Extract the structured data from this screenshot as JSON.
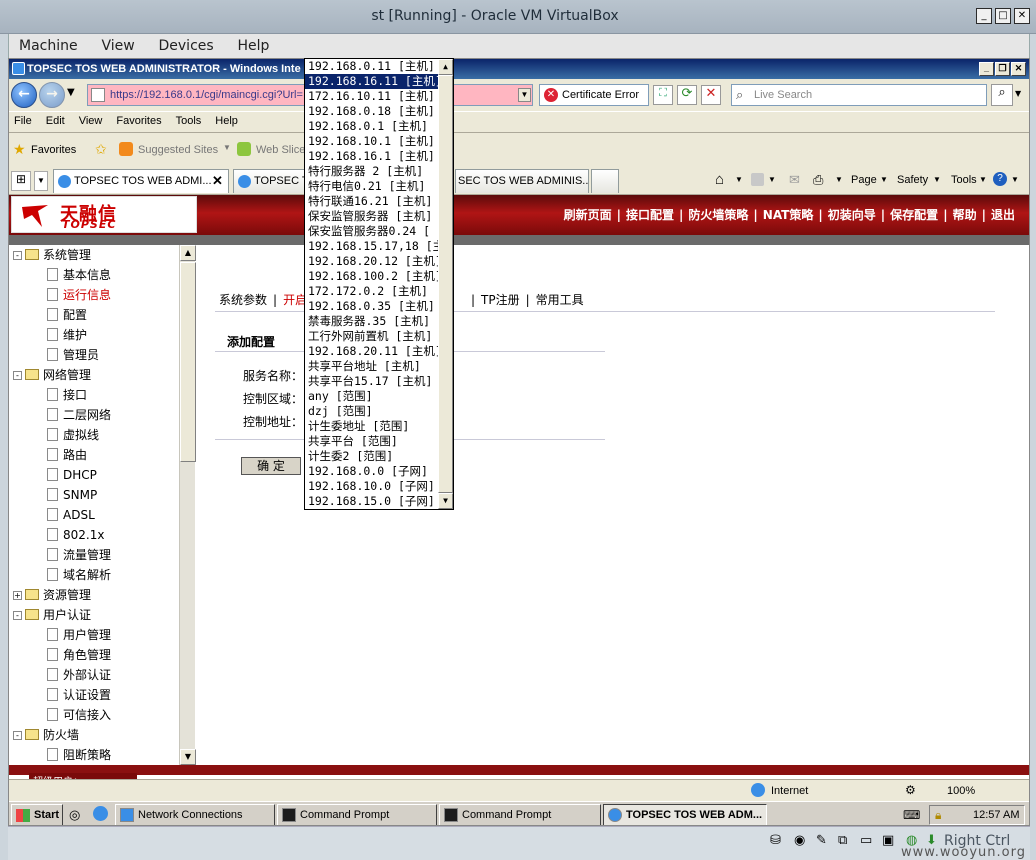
{
  "vbox": {
    "title": "st [Running] - Oracle VM VirtualBox",
    "menu": [
      "Machine",
      "View",
      "Devices",
      "Help"
    ],
    "host_key": "Right Ctrl",
    "watermark": "www.wooyun.org"
  },
  "ie": {
    "title": "TOPSEC TOS WEB ADMINISTRATOR - Windows Inte",
    "url": "https://192.168.0.1/cgi/maincgi.cgi?Url=",
    "cert_error": "Certificate Error",
    "search_placeholder": "Live Search",
    "menu": [
      "File",
      "Edit",
      "View",
      "Favorites",
      "Tools",
      "Help"
    ],
    "favorites_label": "Favorites",
    "suggested_sites": "Suggested Sites",
    "web_slice": "Web Slice",
    "tabs": [
      "TOPSEC TOS WEB ADMI...",
      "TOPSEC TO",
      "SEC TOS WEB ADMINIS..."
    ],
    "cmd_page": "Page",
    "cmd_safety": "Safety",
    "cmd_tools": "Tools",
    "status_zone": "Internet",
    "zoom": "100%"
  },
  "app": {
    "logo_cn": "天融信",
    "logo_en": "TOPSEC",
    "topnav": [
      "刷新页面",
      "接口配置",
      "防火墙策略",
      "NAT策略",
      "初装向导",
      "保存配置",
      "帮助",
      "退出"
    ],
    "sidebar": [
      {
        "label": "系统管理",
        "type": "folder",
        "level": 0,
        "sign": "-"
      },
      {
        "label": "基本信息",
        "type": "doc",
        "level": 1
      },
      {
        "label": "运行信息",
        "type": "doc",
        "level": 1,
        "active": true
      },
      {
        "label": "配置",
        "type": "doc",
        "level": 1
      },
      {
        "label": "维护",
        "type": "doc",
        "level": 1
      },
      {
        "label": "管理员",
        "type": "doc",
        "level": 1
      },
      {
        "label": "网络管理",
        "type": "folder",
        "level": 0,
        "sign": "-"
      },
      {
        "label": "接口",
        "type": "doc",
        "level": 1
      },
      {
        "label": "二层网络",
        "type": "doc",
        "level": 1
      },
      {
        "label": "虚拟线",
        "type": "doc",
        "level": 1
      },
      {
        "label": "路由",
        "type": "doc",
        "level": 1
      },
      {
        "label": "DHCP",
        "type": "doc",
        "level": 1
      },
      {
        "label": "SNMP",
        "type": "doc",
        "level": 1
      },
      {
        "label": "ADSL",
        "type": "doc",
        "level": 1
      },
      {
        "label": "802.1x",
        "type": "doc",
        "level": 1
      },
      {
        "label": "流量管理",
        "type": "doc",
        "level": 1
      },
      {
        "label": "域名解析",
        "type": "doc",
        "level": 1
      },
      {
        "label": "资源管理",
        "type": "folder",
        "level": 0,
        "sign": "+"
      },
      {
        "label": "用户认证",
        "type": "folder",
        "level": 0,
        "sign": "-"
      },
      {
        "label": "用户管理",
        "type": "doc",
        "level": 1
      },
      {
        "label": "角色管理",
        "type": "doc",
        "level": 1
      },
      {
        "label": "外部认证",
        "type": "doc",
        "level": 1
      },
      {
        "label": "认证设置",
        "type": "doc",
        "level": 1
      },
      {
        "label": "可信接入",
        "type": "doc",
        "level": 1
      },
      {
        "label": "防火墙",
        "type": "folder",
        "level": 0,
        "sign": "-"
      },
      {
        "label": "阻断策略",
        "type": "doc",
        "level": 1
      }
    ],
    "content_tabs": [
      "系统参数",
      "开启",
      "TP注册",
      "常用工具"
    ],
    "section_title": "添加配置",
    "form": {
      "service_name": "服务名称：",
      "control_zone": "控制区域：",
      "control_addr": "控制地址："
    },
    "ok_button": "确 定",
    "footer_user": "超级用户：superman"
  },
  "dropdown": {
    "items": [
      "192.168.0.11 [主机]",
      "192.168.16.11 [主机]",
      "172.16.10.11 [主机]",
      "192.168.0.18 [主机]",
      "192.168.0.1 [主机]",
      "192.168.10.1 [主机]",
      "192.168.16.1 [主机]",
      "特行服务器 2 [主机]",
      "特行电信0.21 [主机]",
      "特行联通16.21 [主机]",
      "保安监管服务器 [主机]",
      "保安监管服务器0.24 [",
      "192.168.15.17,18 [主",
      "192.168.20.12 [主机]",
      "192.168.100.2 [主机]",
      "172.172.0.2 [主机]",
      "192.168.0.35 [主机]",
      "禁毒服务器.35 [主机]",
      "工行外网前置机 [主机]",
      "192.168.20.11 [主机]",
      "共享平台地址 [主机]",
      "共享平台15.17 [主机]",
      "any [范围]",
      "dzj [范围]",
      "计生委地址 [范围]",
      "共享平台 [范围]",
      "计生委2 [范围]",
      "192.168.0.0 [子网]",
      "192.168.10.0 [子网]",
      "192.168.15.0 [子网]"
    ],
    "selected_index": 1
  },
  "taskbar": {
    "start": "Start",
    "buttons": [
      "Network Connections",
      "Command Prompt",
      "Command Prompt",
      "TOPSEC TOS WEB ADM..."
    ],
    "clock": "12:57 AM"
  },
  "colors": {
    "banner_red": "#b01515",
    "selected_blue": "#0a246a",
    "url_error_pink": "#ffb6c1"
  }
}
